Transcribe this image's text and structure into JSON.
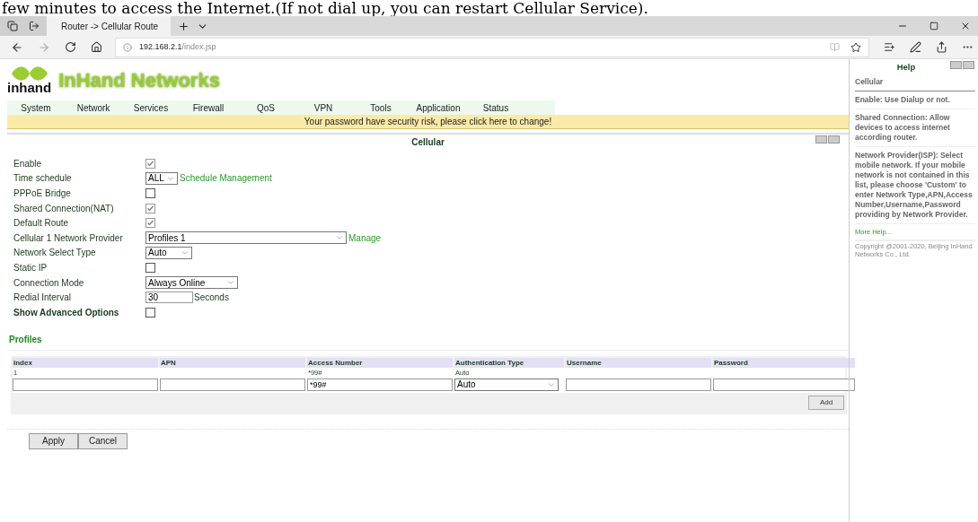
{
  "caption": "few minutes to access the Internet.(If not dial up, you can restart Cellular Service).",
  "browser": {
    "tab_title": "Router -> Cellular Route",
    "url_host": "192.168.2.1",
    "url_path": "/index.jsp"
  },
  "logo": {
    "word": "inhand",
    "title": "InHand Networks"
  },
  "menu": [
    "System",
    "Network",
    "Services",
    "Firewall",
    "QoS",
    "VPN",
    "Tools",
    "Application",
    "Status"
  ],
  "warning": "Your password have security risk, please click here to change!",
  "section_title": "Cellular",
  "fields": [
    {
      "label": "Enable",
      "kind": "checkbox",
      "checked": true
    },
    {
      "label": "Time schedule",
      "kind": "select",
      "value": "ALL",
      "link": "Schedule Management"
    },
    {
      "label": "PPPoE Bridge",
      "kind": "checkbox",
      "checked": false
    },
    {
      "label": "Shared Connection(NAT)",
      "kind": "checkbox",
      "checked": true
    },
    {
      "label": "Default Route",
      "kind": "checkbox",
      "checked": true
    },
    {
      "label": "Cellular 1 Network Provider",
      "kind": "select",
      "value": "Profiles 1",
      "link": "Manage"
    },
    {
      "label": "Network Select Type",
      "kind": "select",
      "value": "Auto"
    },
    {
      "label": "Static IP",
      "kind": "checkbox",
      "checked": false
    },
    {
      "label": "Connection Mode",
      "kind": "select",
      "value": "Always Online"
    },
    {
      "label": "Redial Interval",
      "kind": "input",
      "value": "30",
      "unit": "Seconds"
    },
    {
      "label": "Show Advanced Options",
      "kind": "checkbox",
      "checked": false,
      "bold": true
    }
  ],
  "profiles": {
    "title": "Profiles",
    "columns": [
      "Index",
      "APN",
      "Access Number",
      "Authentication Type",
      "Username",
      "Password"
    ],
    "rows": [
      [
        "1",
        "",
        "*99#",
        "Auto",
        "",
        ""
      ]
    ],
    "new_row": {
      "access_number": "*99#",
      "auth_type": "Auto"
    },
    "add": "Add"
  },
  "buttons": [
    "Apply",
    "Cancel"
  ],
  "help": {
    "title": "Help",
    "heading": "Cellular",
    "items": [
      "Enable: Use Dialup or not.",
      "Shared Connection: Allow devices to access internet according router.",
      "Network Provider(ISP): Select mobile network. If your mobile network is not contained in this list, please choose 'Custom' to enter Network Type,APN,Access Number,Username,Password providing by Network Provider."
    ],
    "more": "More Help...",
    "copyright": "Copyright @2001-2020, Beijing InHand Networks Co., Ltd."
  }
}
